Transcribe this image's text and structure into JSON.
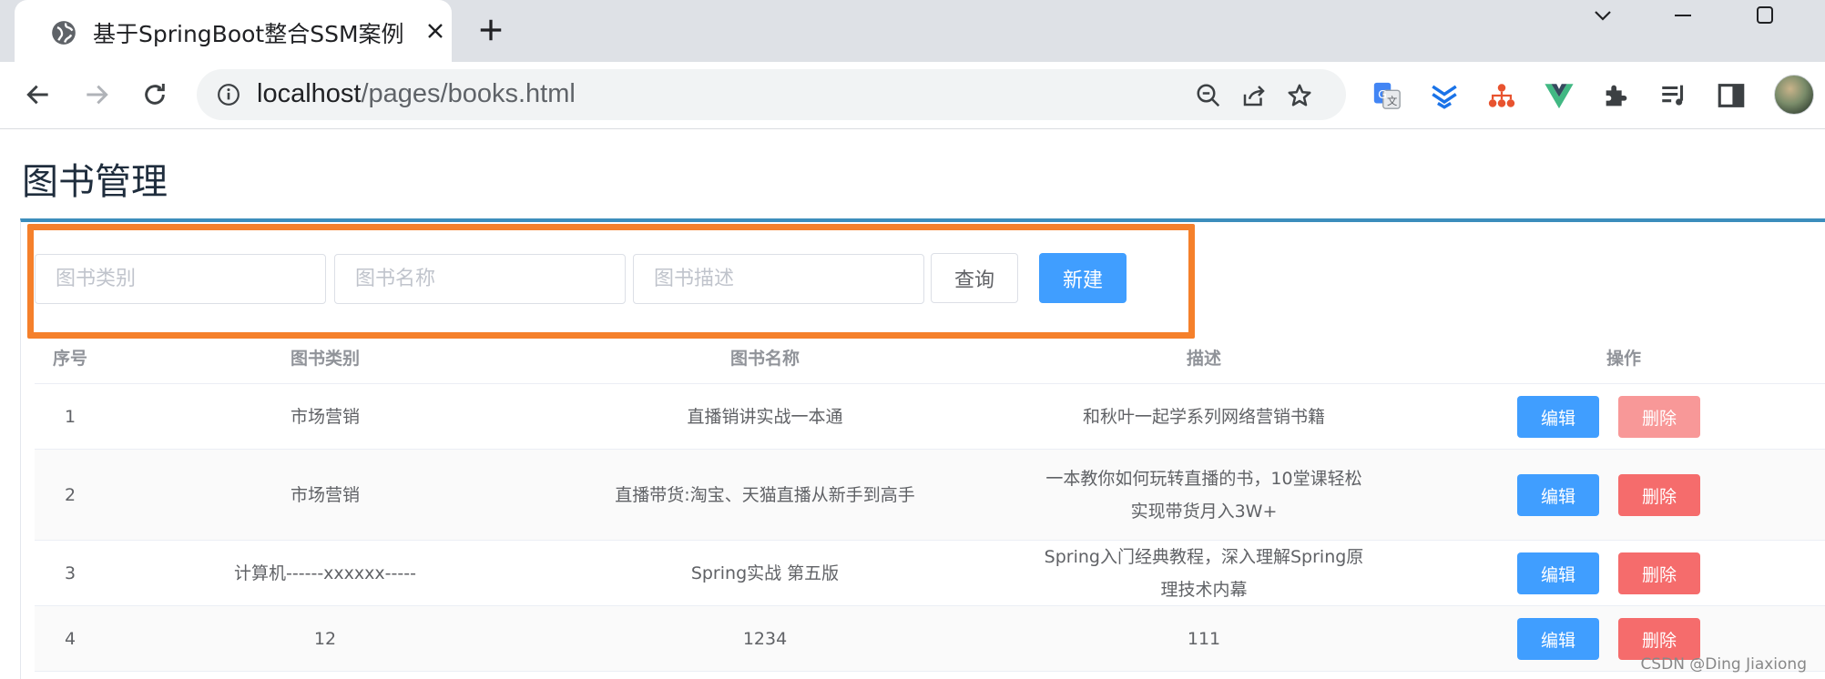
{
  "browser": {
    "tab_title": "基于SpringBoot整合SSM案例",
    "url_host": "localhost",
    "url_path": "/pages/books.html",
    "icons": [
      "globe-icon",
      "close-icon",
      "plus-icon",
      "chevron-down-icon",
      "minimize-icon",
      "maximize-icon",
      "back-arrow-icon",
      "forward-arrow-icon",
      "reload-icon",
      "info-icon",
      "zoom-out-icon",
      "share-icon",
      "star-icon",
      "translate-extension-icon",
      "download-extension-icon",
      "sitemap-extension-icon",
      "vue-devtools-icon",
      "puzzle-extensions-icon",
      "media-queue-icon",
      "side-panel-icon",
      "profile-avatar"
    ]
  },
  "page": {
    "title": "图书管理"
  },
  "filters": {
    "type_placeholder": "图书类别",
    "name_placeholder": "图书名称",
    "desc_placeholder": "图书描述",
    "query_label": "查询",
    "create_label": "新建"
  },
  "table": {
    "headers": {
      "idx": "序号",
      "type": "图书类别",
      "name": "图书名称",
      "desc": "描述",
      "ops": "操作"
    },
    "edit_label": "编辑",
    "delete_label": "删除",
    "rows": [
      {
        "idx": "1",
        "type": "市场营销",
        "name": "直播销讲实战一本通",
        "desc": "和秋叶一起学系列网络营销书籍"
      },
      {
        "idx": "2",
        "type": "市场营销",
        "name": "直播带货:淘宝、天猫直播从新手到高手",
        "desc": "一本教你如何玩转直播的书，10堂课轻松实现带货月入3W+"
      },
      {
        "idx": "3",
        "type": "计算机------xxxxxx-----",
        "name": "Spring实战 第五版",
        "desc": "Spring入门经典教程，深入理解Spring原理技术内幕"
      },
      {
        "idx": "4",
        "type": "12",
        "name": "1234",
        "desc": "111"
      }
    ]
  },
  "watermark": "CSDN @Ding Jiaxiong",
  "colors": {
    "primary": "#409eff",
    "danger": "#f56c6c",
    "highlight": "#f5802b",
    "card_border": "#3c8dbc"
  }
}
